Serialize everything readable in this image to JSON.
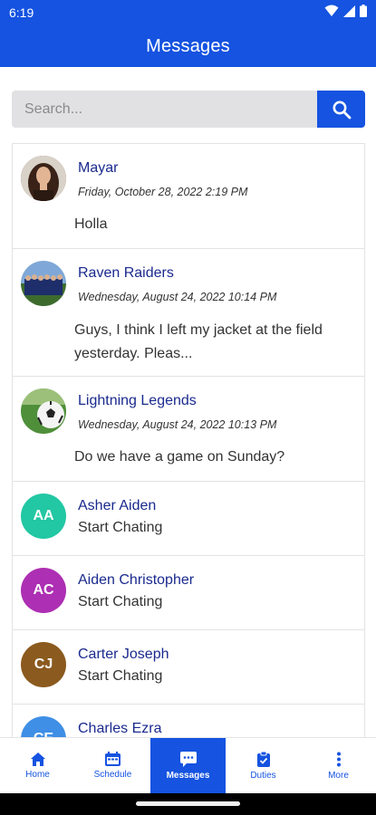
{
  "status": {
    "time": "6:19"
  },
  "header": {
    "title": "Messages"
  },
  "search": {
    "placeholder": "Search..."
  },
  "conversations": [
    {
      "name": "Mayar",
      "date": "Friday, October 28, 2022 2:19 PM",
      "preview": "Holla",
      "avatar": "photo-woman"
    },
    {
      "name": "Raven Raiders",
      "date": "Wednesday, August 24, 2022 10:14 PM",
      "preview": "Guys, I think I left my jacket at the field yesterday. Pleas...",
      "avatar": "photo-team"
    },
    {
      "name": "Lightning Legends",
      "date": "Wednesday, August 24, 2022 10:13 PM",
      "preview": "Do we have a game on Sunday?",
      "avatar": "photo-soccer-ball"
    },
    {
      "name": "Asher Aiden",
      "initials": "AA",
      "subtitle": "Start Chating",
      "color": "#22c7a3"
    },
    {
      "name": "Aiden Christopher",
      "initials": "AC",
      "subtitle": "Start Chating",
      "color": "#ad2fb3"
    },
    {
      "name": "Carter Joseph",
      "initials": "CJ",
      "subtitle": "Start Chating",
      "color": "#8b5a1e"
    },
    {
      "name": "Charles Ezra",
      "initials": "CE",
      "subtitle": "",
      "color": "#3f8fe6"
    }
  ],
  "nav": [
    {
      "label": "Home",
      "icon": "home-icon"
    },
    {
      "label": "Schedule",
      "icon": "calendar-icon"
    },
    {
      "label": "Messages",
      "icon": "chat-icon",
      "active": true
    },
    {
      "label": "Duties",
      "icon": "clipboard-icon"
    },
    {
      "label": "More",
      "icon": "more-vertical-icon"
    }
  ]
}
